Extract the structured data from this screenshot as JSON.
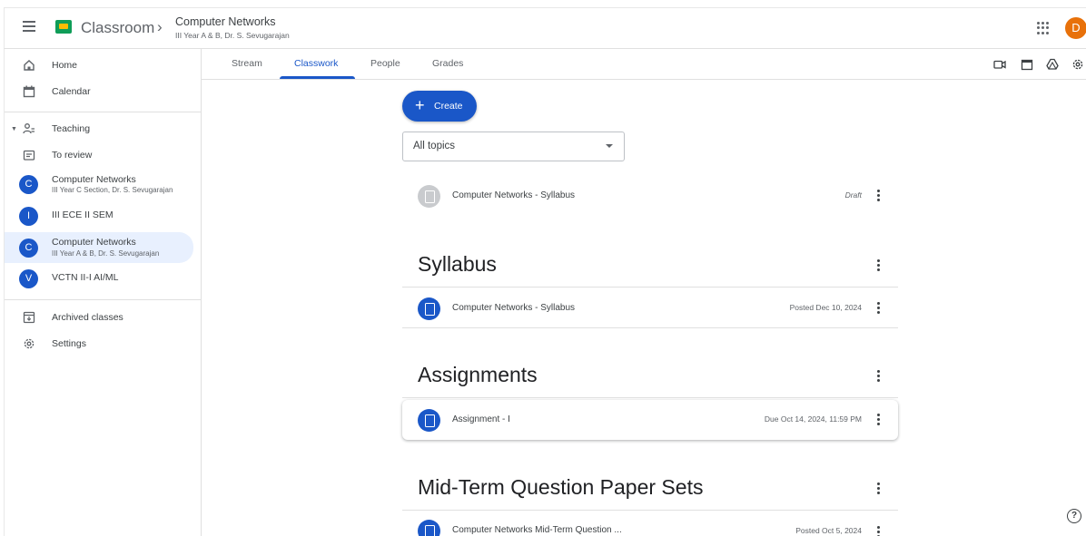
{
  "header": {
    "app_title": "Classroom",
    "breadcrumb_separator": "›",
    "class_title": "Computer Networks",
    "class_subtitle": "III Year A & B, Dr. S. Sevugarajan",
    "avatar_letter": "D",
    "icons": [
      "menu-icon",
      "classroom-logo",
      "apps-grid-icon",
      "account-avatar"
    ]
  },
  "sidebar": {
    "home": "Home",
    "calendar": "Calendar",
    "teaching": "Teaching",
    "to_review": "To review",
    "classes": [
      {
        "letter": "C",
        "name": "Computer Networks",
        "sub": "III Year C Section, Dr. S. Sevugarajan"
      },
      {
        "letter": "I",
        "name": "III ECE II SEM",
        "sub": ""
      },
      {
        "letter": "C",
        "name": "Computer Networks",
        "sub": "III Year A & B, Dr. S. Sevugarajan"
      },
      {
        "letter": "V",
        "name": "VCTN II-I AI/ML",
        "sub": ""
      }
    ],
    "archived": "Archived classes",
    "settings": "Settings"
  },
  "tabs": [
    "Stream",
    "Classwork",
    "People",
    "Grades"
  ],
  "active_tab": "Classwork",
  "tab_icons": [
    "meet-icon",
    "calendar-icon",
    "drive-icon",
    "settings-icon"
  ],
  "main": {
    "create_label": "Create",
    "topic_filter": "All topics",
    "draft_item": {
      "title": "Computer Networks - Syllabus",
      "meta": "Draft"
    },
    "sections": [
      {
        "title": "Syllabus",
        "item": {
          "title": "Computer Networks - Syllabus",
          "meta": "Posted Dec 10, 2024"
        }
      },
      {
        "title": "Assignments",
        "item": {
          "title": "Assignment - I",
          "meta": "Due Oct 14, 2024, 11:59 PM"
        }
      },
      {
        "title": "Mid-Term Question Paper Sets",
        "item": {
          "title": "Computer Networks Mid-Term Question ...",
          "meta": "Posted Oct 5, 2024"
        }
      }
    ]
  },
  "help_glyph": "?",
  "colors": {
    "accent": "#1a57c8",
    "active_bg": "#e8f0fe",
    "avatar": "#e8710a",
    "logo_green": "#0f9d58"
  }
}
